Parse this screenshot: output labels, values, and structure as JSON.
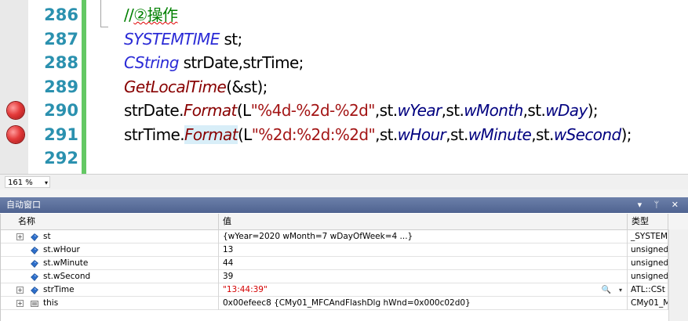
{
  "editor": {
    "lines": [
      {
        "num": "286",
        "breakpoint": false,
        "tokens": [
          {
            "t": "//",
            "c": "t-comment"
          },
          {
            "t": "②操作",
            "c": "t-comment squiggle"
          }
        ]
      },
      {
        "num": "287",
        "breakpoint": false,
        "tokens": [
          {
            "t": "SYSTEMTIME",
            "c": "t-type"
          },
          {
            "t": " st;",
            "c": "t-plain"
          }
        ]
      },
      {
        "num": "288",
        "breakpoint": false,
        "tokens": [
          {
            "t": "CString",
            "c": "t-type"
          },
          {
            "t": " strDate,strTime;",
            "c": "t-plain"
          }
        ]
      },
      {
        "num": "289",
        "breakpoint": false,
        "tokens": [
          {
            "t": "GetLocalTime",
            "c": "t-func"
          },
          {
            "t": "(&st);",
            "c": "t-plain"
          }
        ]
      },
      {
        "num": "290",
        "breakpoint": true,
        "tokens": [
          {
            "t": "strDate.",
            "c": "t-plain"
          },
          {
            "t": "Format",
            "c": "t-func"
          },
          {
            "t": "(L",
            "c": "t-plain"
          },
          {
            "t": "\"%4d-%2d-%2d\"",
            "c": "t-str"
          },
          {
            "t": ",st.",
            "c": "t-plain"
          },
          {
            "t": "wYear",
            "c": "t-mem"
          },
          {
            "t": ",st.",
            "c": "t-plain"
          },
          {
            "t": "wMonth",
            "c": "t-mem"
          },
          {
            "t": ",st.",
            "c": "t-plain"
          },
          {
            "t": "wDay",
            "c": "t-mem"
          },
          {
            "t": ");",
            "c": "t-plain"
          }
        ]
      },
      {
        "num": "291",
        "breakpoint": true,
        "tokens": [
          {
            "t": "strTime.",
            "c": "t-plain"
          },
          {
            "t": "Format",
            "c": "t-func hl-fmt"
          },
          {
            "t": "(L",
            "c": "t-plain"
          },
          {
            "t": "\"%2d:%2d:%2d\"",
            "c": "t-str"
          },
          {
            "t": ",st.",
            "c": "t-plain"
          },
          {
            "t": "wHour",
            "c": "t-mem"
          },
          {
            "t": ",st.",
            "c": "t-plain"
          },
          {
            "t": "wMinute",
            "c": "t-mem"
          },
          {
            "t": ",st.",
            "c": "t-plain"
          },
          {
            "t": "wSecond",
            "c": "t-mem"
          },
          {
            "t": ");",
            "c": "t-plain"
          }
        ]
      },
      {
        "num": "292",
        "breakpoint": false,
        "tokens": []
      }
    ]
  },
  "zoom": {
    "value": "161 %",
    "arrow": "▾"
  },
  "autos": {
    "title": "自动窗口",
    "title_buttons": "▾ ᛘ ✕",
    "columns": {
      "name": "名称",
      "value": "值",
      "type": "类型"
    },
    "rows": [
      {
        "expandable": true,
        "icon": "field-icon",
        "name": "st",
        "value": "{wYear=2020 wMonth=7 wDayOfWeek=4 ...}",
        "value_red": false,
        "type": "_SYSTEM",
        "search": false
      },
      {
        "expandable": false,
        "icon": "field-icon",
        "name": "st.wHour",
        "value": "13",
        "value_red": false,
        "type": "unsigned",
        "search": false
      },
      {
        "expandable": false,
        "icon": "field-icon",
        "name": "st.wMinute",
        "value": "44",
        "value_red": false,
        "type": "unsigned",
        "search": false
      },
      {
        "expandable": false,
        "icon": "field-icon",
        "name": "st.wSecond",
        "value": "39",
        "value_red": false,
        "type": "unsigned",
        "search": false
      },
      {
        "expandable": true,
        "icon": "field-icon",
        "name": "strTime",
        "value": "\"13:44:39\"",
        "value_red": true,
        "type": "ATL::CSt",
        "search": true
      },
      {
        "expandable": true,
        "icon": "pointer-icon",
        "name": "this",
        "value": "0x00efeec8 {CMy01_MFCAndFlashDlg hWnd=0x000c02d0}",
        "value_red": false,
        "type": "CMy01_M",
        "search": false
      }
    ]
  },
  "colors": {
    "breakpoint": "#e43b3b",
    "line_number": "#2b91af",
    "change_bar": "#64c864",
    "title_bar": "#5a6e99"
  }
}
